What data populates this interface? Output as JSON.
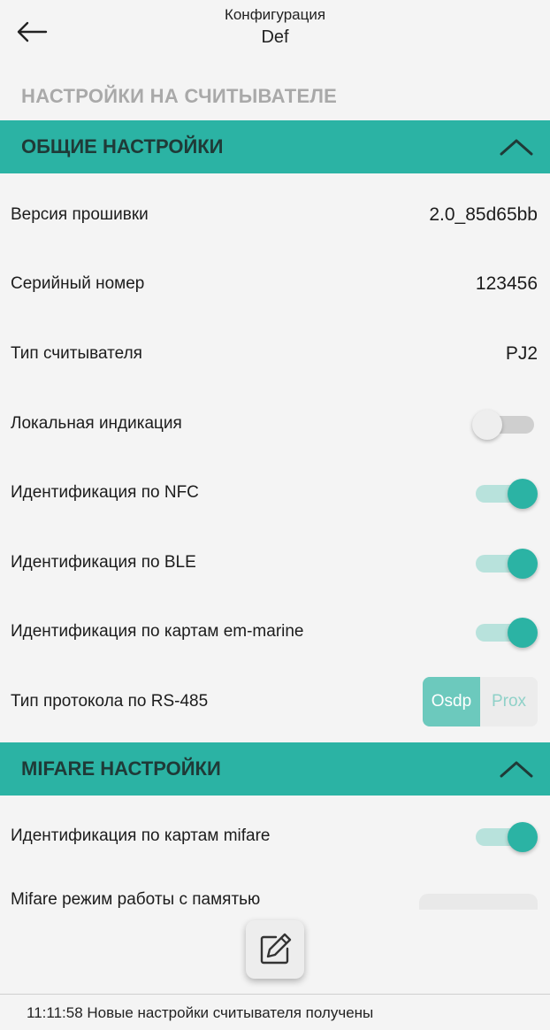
{
  "header": {
    "title": "Конфигурация",
    "subtitle": "Def",
    "back_icon": "arrow-left-icon"
  },
  "page_heading": "НАСТРОЙКИ НА СЧИТЫВАТЕЛЕ",
  "sections": {
    "general": {
      "title": "ОБЩИЕ НАСТРОЙКИ",
      "expanded": true,
      "rows": {
        "firmware": {
          "label": "Версия прошивки",
          "value": "2.0_85d65bb"
        },
        "serial": {
          "label": "Серийный номер",
          "value": "123456"
        },
        "reader_type": {
          "label": "Тип считывателя",
          "value": "PJ2"
        },
        "local_indication": {
          "label": "Локальная индикация",
          "enabled": false
        },
        "nfc": {
          "label": "Идентификация по NFC",
          "enabled": true
        },
        "ble": {
          "label": "Идентификация по BLE",
          "enabled": true
        },
        "em_marine": {
          "label": "Идентификация по картам em-marine",
          "enabled": true
        },
        "rs485": {
          "label": "Тип протокола по RS-485",
          "options": [
            "Osdp",
            "Prox"
          ],
          "selected": "Osdp"
        }
      }
    },
    "mifare": {
      "title": "MIFARE НАСТРОЙКИ",
      "expanded": true,
      "rows": {
        "mifare_id": {
          "label": "Идентификация по картам mifare",
          "enabled": true
        },
        "memory_mode": {
          "label": "Mifare режим работы с памятью"
        }
      }
    }
  },
  "fab_icon": "edit-icon",
  "status": "11:11:58 Новые настройки считывателя получены",
  "colors": {
    "accent": "#2bb3a4",
    "section_text": "#1f3a37",
    "heading_gray": "#a9a9a9",
    "background": "#f4f4f4"
  }
}
